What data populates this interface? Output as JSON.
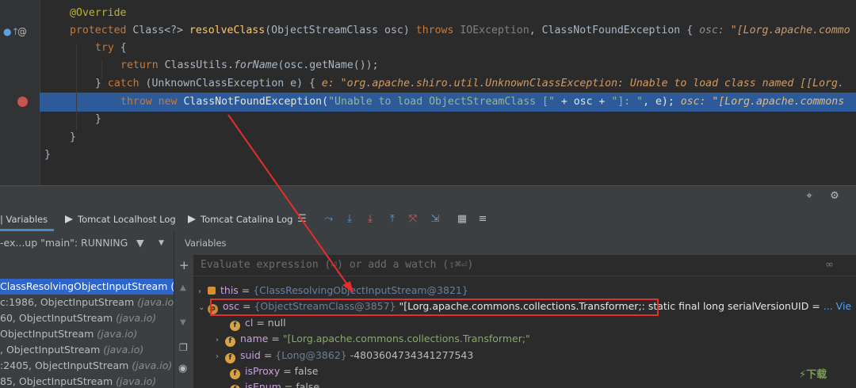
{
  "editor": {
    "line_override": "@Override",
    "line_sig": {
      "kw1": "protected",
      "type": "Class<?>",
      "method": "resolveClass",
      "params": "(ObjectStreamClass osc) ",
      "kw2": "throws",
      "exc1": "IOException",
      "sep": ", ",
      "exc2": "ClassNotFoundException",
      "brace": " {",
      "hint_name": "osc: ",
      "hint_val": "\"[Lorg.apache.commo"
    },
    "line_try": {
      "kw": "try",
      "brace": " {"
    },
    "line_return": {
      "kw": "return",
      "cls": "ClassUtils.",
      "call": "forName",
      "args": "(osc.getName());"
    },
    "line_catch": {
      "open": "} ",
      "kw": "catch",
      "args": " (UnknownClassException e) {",
      "hint": "e: \"org.apache.shiro.util.UnknownClassException: Unable to load class named [[Lorg."
    },
    "line_throw": {
      "kw1": "throw",
      "kw2": "new",
      "cls": "ClassNotFoundException(",
      "str": "\"Unable to load ObjectStreamClass [\"",
      "mid": " + osc + ",
      "str2": "\"]: \"",
      "end": ", e);",
      "hint": "osc: \"[Lorg.apache.commons"
    },
    "line_close1": "}",
    "line_close2": "}",
    "line_close3": "}"
  },
  "tabs": {
    "variables": "| Variables",
    "localhost": "Tomcat Localhost Log",
    "catalina": "Tomcat Catalina Log"
  },
  "vars_header": "Variables",
  "thread": "-ex...up \"main\": RUNNING",
  "eval_placeholder": "Evaluate expression (⏎) or add a watch (⇧⌘⏎)",
  "frames": [
    {
      "name": "ClassResolvingObjectInputStream (",
      "pkg": "",
      "selected": true
    },
    {
      "name": "c:1986, ObjectInputStream ",
      "pkg": "(java.io)",
      "selected": false
    },
    {
      "name": "60, ObjectInputStream ",
      "pkg": "(java.io)",
      "selected": false
    },
    {
      "name": "ObjectInputStream ",
      "pkg": "(java.io)",
      "selected": false
    },
    {
      "name": ", ObjectInputStream ",
      "pkg": "(java.io)",
      "selected": false
    },
    {
      "name": ":2405, ObjectInputStream ",
      "pkg": "(java.io)",
      "selected": false
    },
    {
      "name": "85, ObjectInputStream ",
      "pkg": "(java.io)",
      "selected": false
    }
  ],
  "vars": {
    "this": {
      "name": "this",
      "eq": " = ",
      "type": "{ClassResolvingObjectInputStream@3821}"
    },
    "osc": {
      "name": "osc",
      "eq": " = ",
      "type": "{ObjectStreamClass@3857} ",
      "val": "\"[Lorg.apache.commons.collections.Transformer;: static final long serialVersionUID = ",
      "more": "... Vie"
    },
    "cl": {
      "name": "cl",
      "eq": " = ",
      "val": "null"
    },
    "name": {
      "name": "name",
      "eq": " = ",
      "val": "\"[Lorg.apache.commons.collections.Transformer;\""
    },
    "suid": {
      "name": "suid",
      "eq": " = ",
      "type": "{Long@3862} ",
      "val": "-4803604734341277543"
    },
    "isProxy": {
      "name": "isProxy",
      "eq": " = ",
      "val": "false"
    },
    "isEnum": {
      "name": "isEnum",
      "eq": " = ",
      "val": "false"
    }
  },
  "watermark": "⚡下载",
  "colors": {
    "exec_line": "#2d5a99",
    "highlight_box": "#e52d2d",
    "arrow": "#e52d2d"
  }
}
